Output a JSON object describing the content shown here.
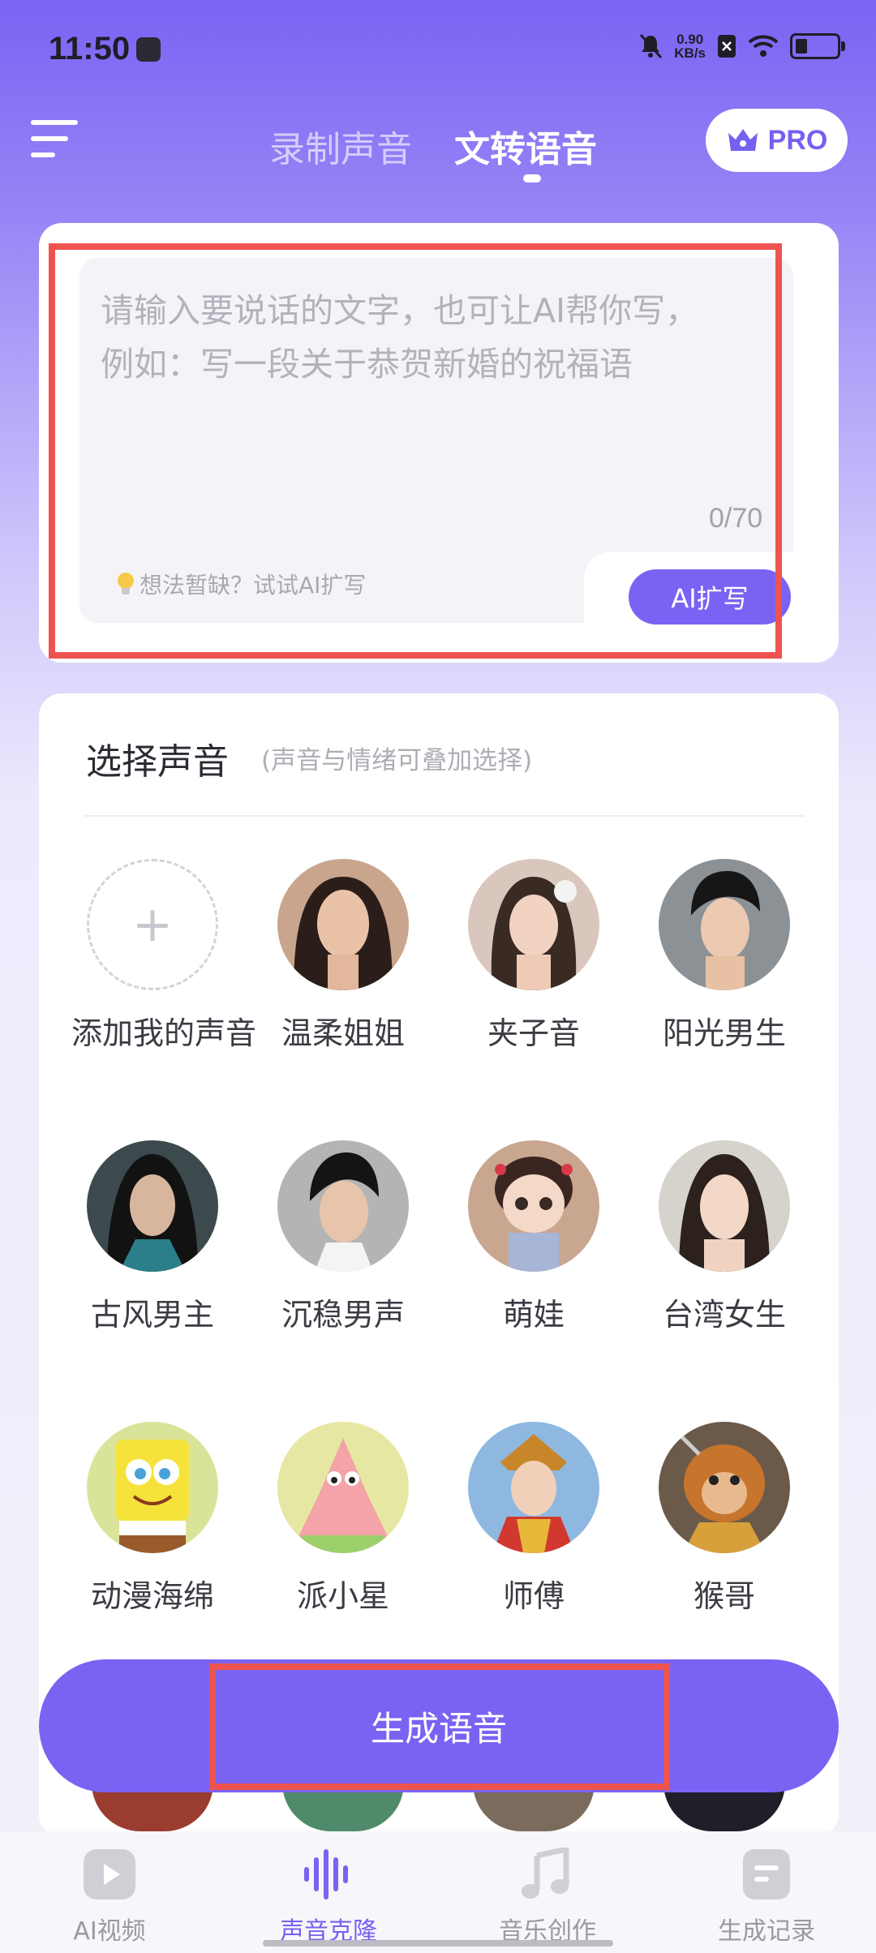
{
  "status": {
    "time": "11:50",
    "speed_value": "0.90",
    "speed_unit": "KB/s"
  },
  "header": {
    "tabs": [
      {
        "label": "录制声音",
        "active": false
      },
      {
        "label": "文转语音",
        "active": true
      }
    ],
    "pro_label": "PRO"
  },
  "text_input": {
    "placeholder_line1": "请输入要说话的文字，也可让AI帮你写，",
    "placeholder_line2": "例如：写一段关于恭贺新婚的祝福语",
    "counter": "0/70",
    "hint": "想法暂缺？试试AI扩写",
    "ai_button": "AI扩写"
  },
  "voices": {
    "title": "选择声音",
    "subtitle": "(声音与情绪可叠加选择)",
    "items": [
      {
        "label": "添加我的声音",
        "icon": "add-icon"
      },
      {
        "label": "温柔姐姐"
      },
      {
        "label": "夹子音"
      },
      {
        "label": "阳光男生"
      },
      {
        "label": "古风男主"
      },
      {
        "label": "沉稳男声"
      },
      {
        "label": "萌娃"
      },
      {
        "label": "台湾女生"
      },
      {
        "label": "动漫海绵"
      },
      {
        "label": "派小星"
      },
      {
        "label": "师傅"
      },
      {
        "label": "猴哥"
      }
    ]
  },
  "generate_button": "生成语音",
  "bottom_nav": [
    {
      "label": "AI视频",
      "icon": "video-play-icon",
      "active": false
    },
    {
      "label": "声音克隆",
      "icon": "soundwave-icon",
      "active": true
    },
    {
      "label": "音乐创作",
      "icon": "music-note-icon",
      "active": false
    },
    {
      "label": "生成记录",
      "icon": "record-list-icon",
      "active": false
    }
  ],
  "colors": {
    "accent": "#7a63f3",
    "highlight": "#ef5350"
  }
}
